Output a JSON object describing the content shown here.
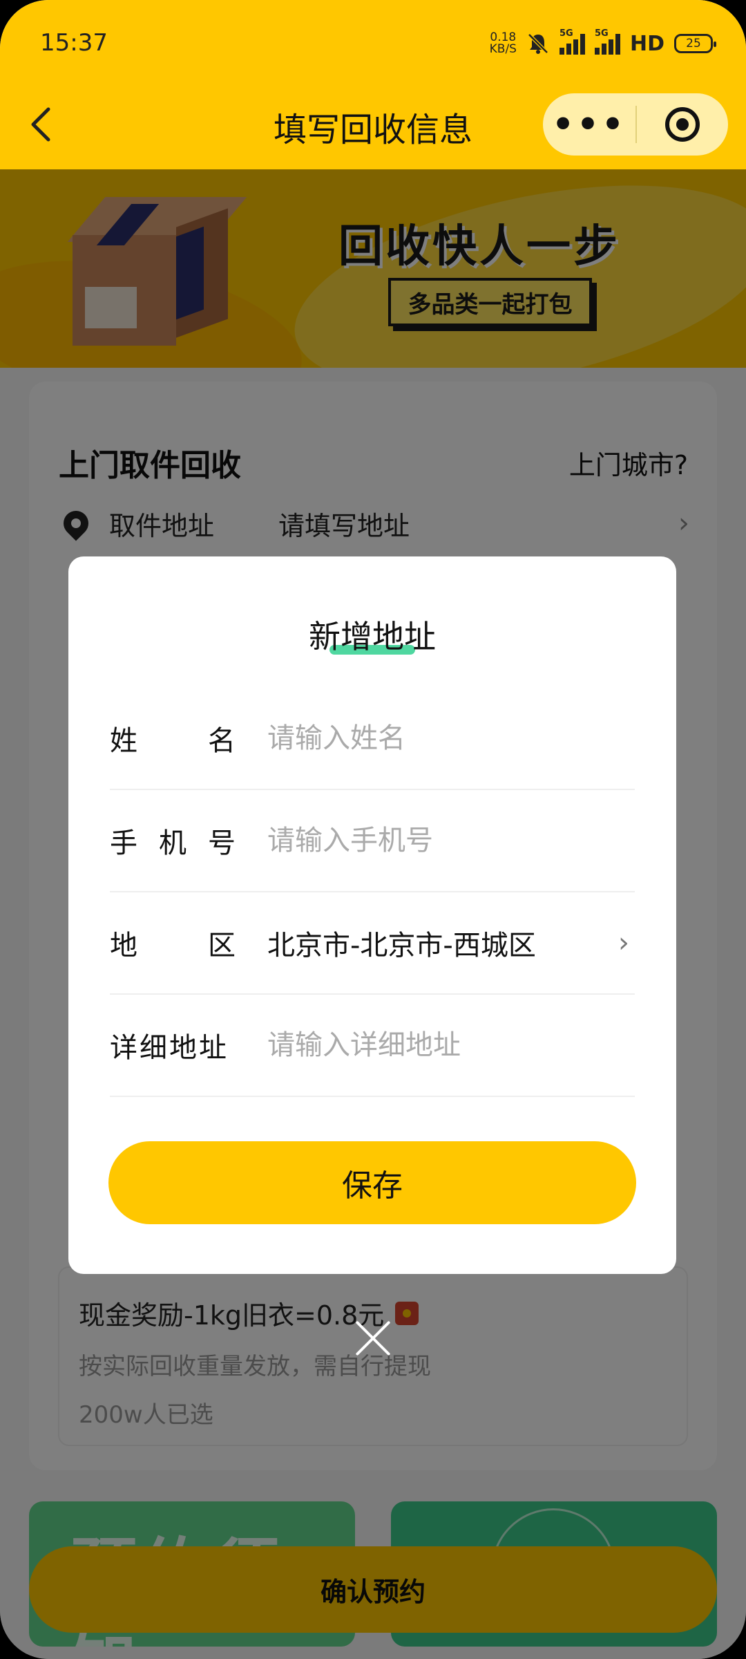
{
  "status_bar": {
    "time": "15:37",
    "net_speed_value": "0.18",
    "net_speed_unit": "KB/S",
    "signal1_label": "5G",
    "signal2_label": "5G",
    "hd_label": "HD",
    "battery": "25"
  },
  "nav": {
    "back_icon": "chevron-left-icon",
    "title": "填写回收信息",
    "more_icon": "more-dots-icon",
    "target_icon": "target-icon"
  },
  "banner": {
    "headline": "回收快人一步",
    "tag": "多品类一起打包"
  },
  "pickup": {
    "title": "上门取件回收",
    "city_link": "上门城市?",
    "address_label": "取件地址",
    "address_value": "请填写地址"
  },
  "reward": {
    "title": "现金奖励-1kg旧衣=0.8元",
    "subtitle": "按实际回收重量发放，需自行提现",
    "count": "200w人已选"
  },
  "promo": {
    "left_text": "预约须知"
  },
  "confirm_button": "确认预约",
  "dialog": {
    "title": "新增地址",
    "fields": {
      "name": {
        "label_a": "姓",
        "label_b": "名",
        "placeholder": "请输入姓名"
      },
      "phone": {
        "label_a": "手",
        "label_b": "机",
        "label_c": "号",
        "placeholder": "请输入手机号"
      },
      "region": {
        "label_a": "地",
        "label_b": "区",
        "value": "北京市-北京市-西城区"
      },
      "detail": {
        "label": "详细地址",
        "placeholder": "请输入详细地址"
      }
    },
    "save_label": "保存",
    "close_icon": "close-icon"
  },
  "colors": {
    "brand_yellow": "#ffc700",
    "accent_green": "#4fd7a0"
  }
}
